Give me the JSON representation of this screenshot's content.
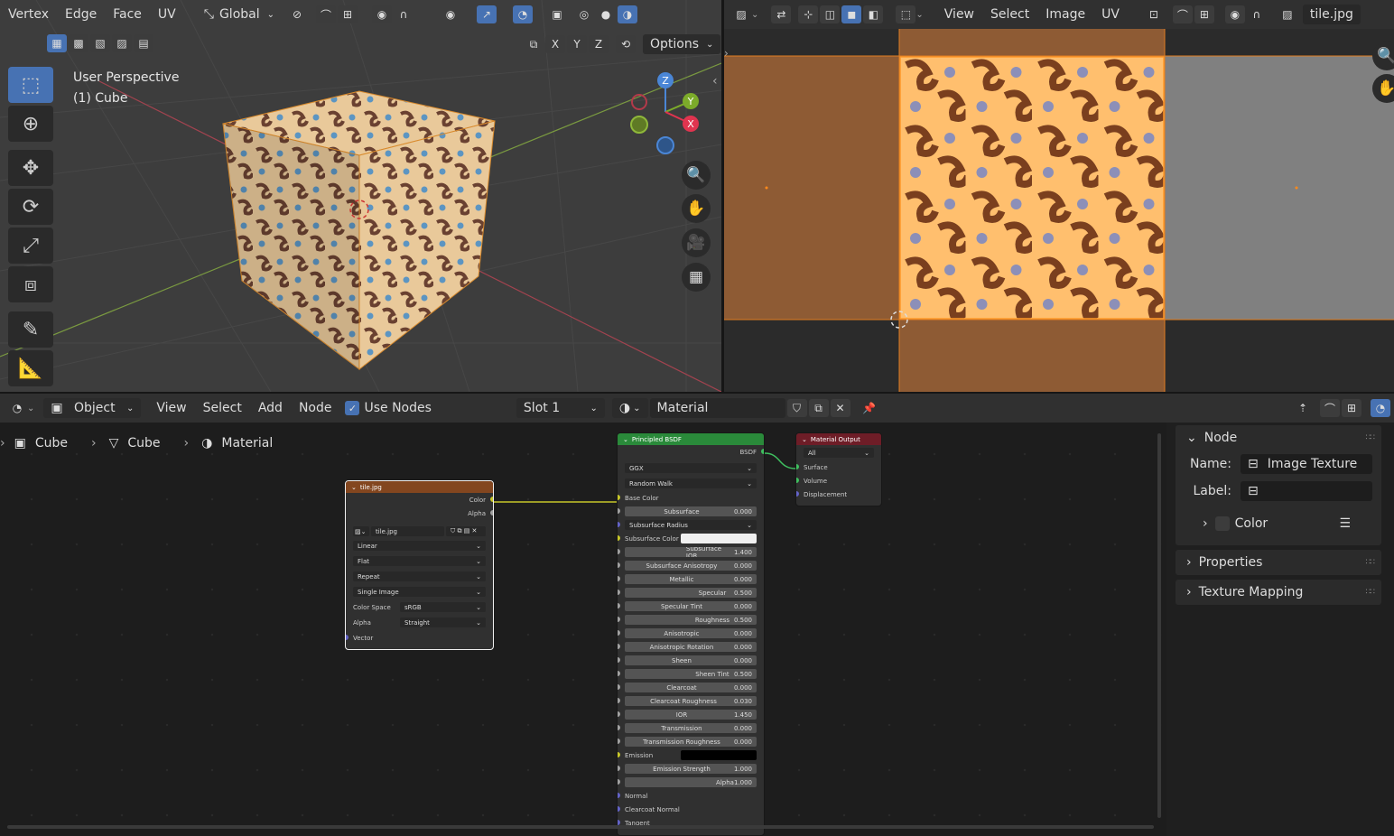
{
  "viewport3d": {
    "header_menus": [
      "Vertex",
      "Edge",
      "Face",
      "UV"
    ],
    "orientation": "Global",
    "options_label": "Options",
    "axis_toggles": [
      "X",
      "Y",
      "Z"
    ],
    "title": "User Perspective",
    "object_label": "(1) Cube",
    "gizmo": {
      "x": "X",
      "y": "Y",
      "z": "Z"
    }
  },
  "uv_editor": {
    "menus": [
      "View",
      "Select",
      "Image",
      "UV"
    ],
    "image_name": "tile.jpg"
  },
  "node_editor": {
    "mode": "Object",
    "menus": [
      "View",
      "Select",
      "Add",
      "Node"
    ],
    "use_nodes_label": "Use Nodes",
    "slot": "Slot 1",
    "material": "Material",
    "breadcrumb": [
      "Cube",
      "Cube",
      "Material"
    ]
  },
  "image_node": {
    "title": "tile.jpg",
    "outputs": [
      "Color",
      "Alpha"
    ],
    "image": "tile.jpg",
    "interpolation": "Linear",
    "projection": "Flat",
    "extension": "Repeat",
    "source": "Single Image",
    "color_space_label": "Color Space",
    "color_space": "sRGB",
    "alpha_label": "Alpha",
    "alpha": "Straight",
    "vector": "Vector"
  },
  "bsdf_node": {
    "title": "Principled BSDF",
    "output": "BSDF",
    "distribution": "GGX",
    "subsurface_method": "Random Walk",
    "base_color": "Base Color",
    "subsurface_color_label": "Subsurface Color",
    "subsurface_color": "#f0f0f0",
    "emission_label": "Emission",
    "emission_color": "#000000",
    "params": [
      {
        "label": "Subsurface",
        "value": "0.000",
        "frac": 0
      },
      {
        "label": "Subsurface Radius",
        "value": "",
        "frac": 0,
        "select": true
      },
      {
        "label": "Subsurface IOR",
        "value": "1.400",
        "frac": 0.47
      },
      {
        "label": "Subsurface Anisotropy",
        "value": "0.000",
        "frac": 0
      },
      {
        "label": "Metallic",
        "value": "0.000",
        "frac": 0
      },
      {
        "label": "Specular",
        "value": "0.500",
        "frac": 0.5
      },
      {
        "label": "Specular Tint",
        "value": "0.000",
        "frac": 0
      },
      {
        "label": "Roughness",
        "value": "0.500",
        "frac": 0.5
      },
      {
        "label": "Anisotropic",
        "value": "0.000",
        "frac": 0
      },
      {
        "label": "Anisotropic Rotation",
        "value": "0.000",
        "frac": 0
      },
      {
        "label": "Sheen",
        "value": "0.000",
        "frac": 0
      },
      {
        "label": "Sheen Tint",
        "value": "0.500",
        "frac": 0.5
      },
      {
        "label": "Clearcoat",
        "value": "0.000",
        "frac": 0
      },
      {
        "label": "Clearcoat Roughness",
        "value": "0.030",
        "frac": 0.03
      },
      {
        "label": "IOR",
        "value": "1.450",
        "frac": 0
      },
      {
        "label": "Transmission",
        "value": "0.000",
        "frac": 0
      },
      {
        "label": "Transmission Roughness",
        "value": "0.000",
        "frac": 0
      },
      {
        "label": "Emission Strength",
        "value": "1.000",
        "frac": 0
      },
      {
        "label": "Alpha",
        "value": "1.000",
        "frac": 1
      }
    ],
    "vector_inputs": [
      "Normal",
      "Clearcoat Normal",
      "Tangent"
    ]
  },
  "output_node": {
    "title": "Material Output",
    "target": "All",
    "inputs": [
      "Surface",
      "Volume",
      "Displacement"
    ]
  },
  "sidebar": {
    "node_panel": "Node",
    "name_label": "Name:",
    "name_value": "Image Texture",
    "label_label": "Label:",
    "label_value": "",
    "color_label": "Color",
    "properties": "Properties",
    "texture_mapping": "Texture Mapping"
  },
  "colors": {
    "accent": "#4772b3",
    "header_bg": "#303030",
    "tex_brown": "#7a4520",
    "tex_orange": "#ffbf6e"
  }
}
